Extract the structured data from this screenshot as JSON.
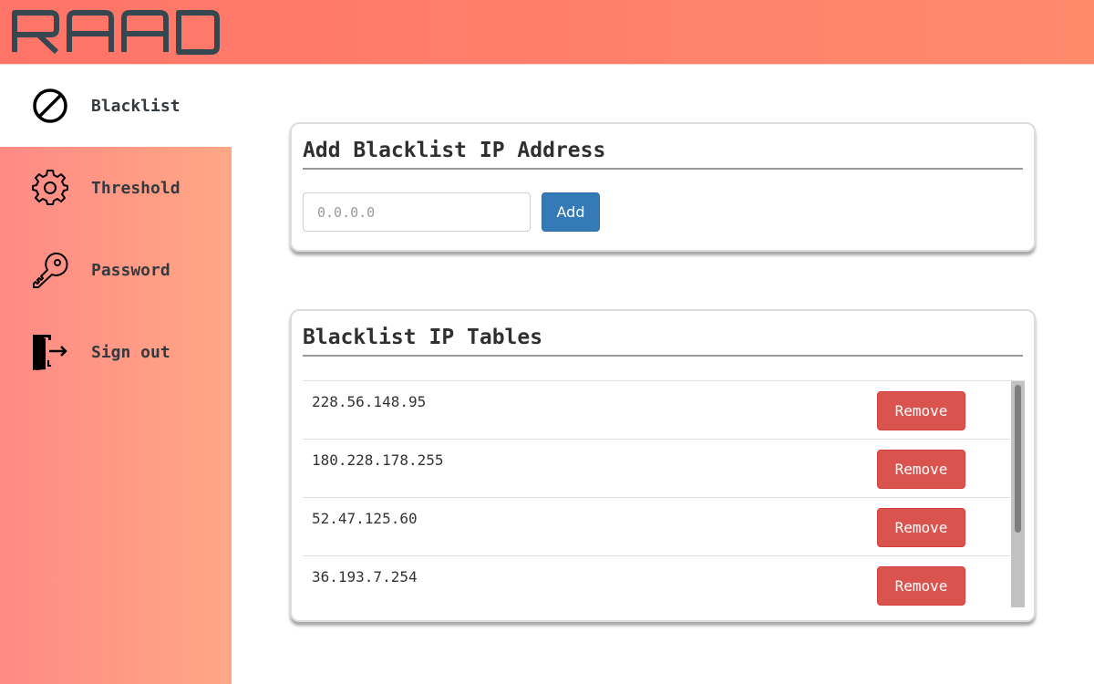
{
  "app": {
    "logo_text": "RAAD"
  },
  "colors": {
    "header_gradient": [
      "#ff7468",
      "#ff8a6c"
    ],
    "sidebar_gradient": [
      "#ff8a85",
      "#ffa785"
    ],
    "primary_button": "#337ab7",
    "danger_button": "#d9534f",
    "logo_color": "#37474f"
  },
  "sidebar": {
    "items": [
      {
        "label": "Blacklist",
        "icon": "ban-icon",
        "active": true
      },
      {
        "label": "Threshold",
        "icon": "gear-icon",
        "active": false
      },
      {
        "label": "Password",
        "icon": "key-icon",
        "active": false
      },
      {
        "label": "Sign out",
        "icon": "sign-out-icon",
        "active": false
      }
    ]
  },
  "add_card": {
    "title": "Add Blacklist IP Address",
    "input_value": "",
    "input_placeholder": "0.0.0.0",
    "add_label": "Add"
  },
  "table_card": {
    "title": "Blacklist IP Tables",
    "rows": [
      {
        "ip": "228.56.148.95",
        "action": "Remove"
      },
      {
        "ip": "180.228.178.255",
        "action": "Remove"
      },
      {
        "ip": "52.47.125.60",
        "action": "Remove"
      },
      {
        "ip": "36.193.7.254",
        "action": "Remove"
      }
    ]
  }
}
